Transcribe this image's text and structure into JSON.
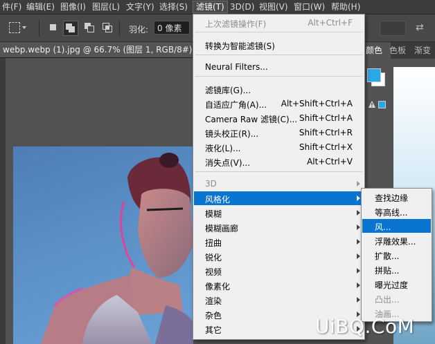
{
  "menubar": {
    "items": [
      {
        "label": "件(F)"
      },
      {
        "label": "编辑(E)"
      },
      {
        "label": "图像(I)"
      },
      {
        "label": "图层(L)"
      },
      {
        "label": "文字(Y)"
      },
      {
        "label": "选择(S)"
      },
      {
        "label": "滤镜(T)"
      },
      {
        "label": "3D(D)"
      },
      {
        "label": "视图(V)"
      },
      {
        "label": "窗口(W)"
      },
      {
        "label": "帮助(H)"
      }
    ]
  },
  "options": {
    "feather_label": "羽化:",
    "feather_value": "0 像素"
  },
  "document_tab": {
    "title": "webp.webp (1).jpg @ 66.7% (图层 1, RGB/8#) *"
  },
  "panels": {
    "tabs": [
      {
        "label": "颜色"
      },
      {
        "label": "色板"
      },
      {
        "label": "渐变"
      }
    ],
    "foreground_color": "#29a8e8",
    "background_color": "#ffffff"
  },
  "filter_menu": {
    "items": [
      {
        "label": "上次滤镜操作(F)",
        "shortcut": "Alt+Ctrl+F",
        "disabled": true
      },
      {
        "label": "转换为智能滤镜(S)",
        "shortcut": ""
      },
      {
        "label": "Neural Filters...",
        "shortcut": ""
      },
      {
        "label": "滤镜库(G)...",
        "shortcut": ""
      },
      {
        "label": "自适应广角(A)...",
        "shortcut": "Alt+Shift+Ctrl+A"
      },
      {
        "label": "Camera Raw 滤镜(C)...",
        "shortcut": "Shift+Ctrl+A"
      },
      {
        "label": "镜头校正(R)...",
        "shortcut": "Shift+Ctrl+R"
      },
      {
        "label": "液化(L)...",
        "shortcut": "Shift+Ctrl+X"
      },
      {
        "label": "消失点(V)...",
        "shortcut": "Alt+Ctrl+V"
      },
      {
        "label": "3D",
        "disabled": true,
        "submenu": true
      },
      {
        "label": "风格化",
        "submenu": true,
        "highlighted": true
      },
      {
        "label": "模糊",
        "submenu": true
      },
      {
        "label": "模糊画廊",
        "submenu": true
      },
      {
        "label": "扭曲",
        "submenu": true
      },
      {
        "label": "锐化",
        "submenu": true
      },
      {
        "label": "视频",
        "submenu": true
      },
      {
        "label": "像素化",
        "submenu": true
      },
      {
        "label": "渲染",
        "submenu": true
      },
      {
        "label": "杂色",
        "submenu": true
      },
      {
        "label": "其它",
        "submenu": true
      }
    ]
  },
  "stylize_submenu": {
    "items": [
      {
        "label": "查找边缘"
      },
      {
        "label": "等高线..."
      },
      {
        "label": "风...",
        "highlighted": true
      },
      {
        "label": "浮雕效果..."
      },
      {
        "label": "扩散..."
      },
      {
        "label": "拼贴..."
      },
      {
        "label": "曝光过度"
      },
      {
        "label": "凸出...",
        "disabled": true
      },
      {
        "label": "油画...",
        "disabled": true
      }
    ]
  },
  "watermark": {
    "text": "UiBQ.CoM"
  }
}
